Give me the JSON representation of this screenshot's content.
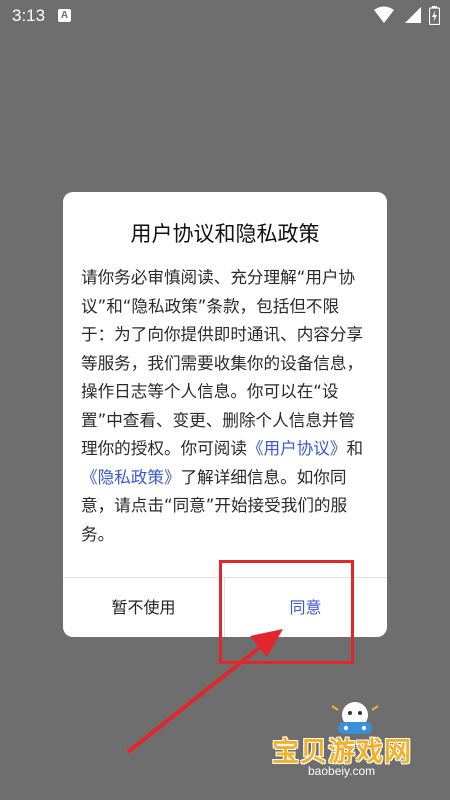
{
  "status_bar": {
    "time": "3:13",
    "notification_icon": "A"
  },
  "dialog": {
    "title": "用户协议和隐私政策",
    "body_part1": "请你务必审慎阅读、充分理解“用户协议”和“隐私政策”条款，包括但不限于：为了向你提供即时通讯、内容分享等服务，我们需要收集你的设备信息，操作日志等个人信息。你可以在“设置”中查看、变更、删除个人信息并管理你的授权。你可阅读",
    "link_user_agreement": "《用户协议》",
    "body_and": "和",
    "link_privacy_policy": "《隐私政策》",
    "body_part2": "了解详细信息。如你同意，请点击“同意”开始接受我们的服务。",
    "cancel_label": "暂不使用",
    "agree_label": "同意"
  },
  "watermark": {
    "title": "宝贝游戏网",
    "url": "baobeiy.com"
  },
  "colors": {
    "link": "#3a59d6",
    "highlight": "#e3262b",
    "overlay": "#6e6e6e"
  }
}
